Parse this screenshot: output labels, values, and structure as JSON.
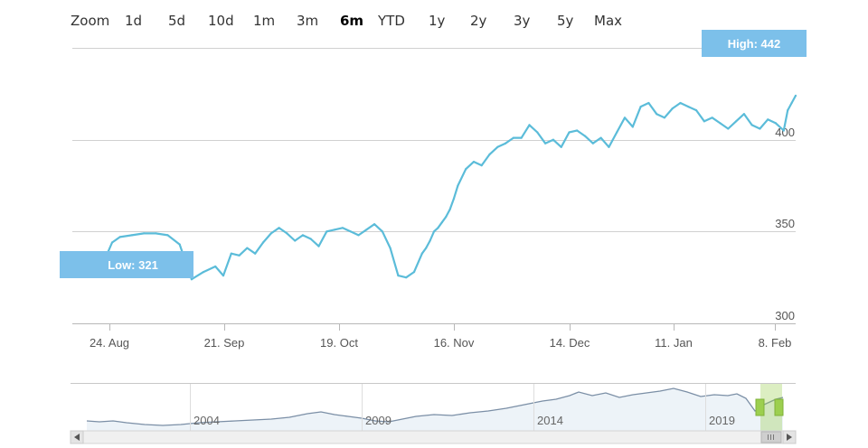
{
  "zoom": {
    "label": "Zoom",
    "buttons": [
      "1d",
      "5d",
      "10d",
      "1m",
      "3m",
      "6m",
      "YTD",
      "1y",
      "2y",
      "3y",
      "5y",
      "Max"
    ],
    "active": "6m"
  },
  "colors": {
    "line": "#5bbcd9",
    "badge": "#7cc0ea",
    "grid": "#d0d0d0",
    "navigator_fill": "#edf3f8",
    "navigator_line": "#7b8fa6",
    "handle": "#9ccf4f"
  },
  "badges": {
    "high": "High: 442",
    "low": "Low: 321"
  },
  "chart_data": {
    "type": "line",
    "title": "",
    "xlabel": "",
    "ylabel": "",
    "ylim": [
      300,
      450
    ],
    "yticks": [
      300,
      350,
      400
    ],
    "grid": true,
    "xticks": [
      "24. Aug",
      "21. Sep",
      "19. Oct",
      "16. Nov",
      "14. Dec",
      "11. Jan",
      "8. Feb"
    ],
    "x_range": [
      "2019-08-12",
      "2020-02-10"
    ],
    "series": [
      {
        "x": [
          "2019-08-12",
          "2019-08-15",
          "2019-08-18",
          "2019-08-21",
          "2019-08-22",
          "2019-08-24",
          "2019-08-27",
          "2019-08-30",
          "2019-09-02",
          "2019-09-05",
          "2019-09-08",
          "2019-09-11",
          "2019-09-14",
          "2019-09-17",
          "2019-09-19",
          "2019-09-21",
          "2019-09-23",
          "2019-09-25",
          "2019-09-27",
          "2019-09-29",
          "2019-10-01",
          "2019-10-03",
          "2019-10-05",
          "2019-10-07",
          "2019-10-09",
          "2019-10-11",
          "2019-10-13",
          "2019-10-15",
          "2019-10-17",
          "2019-10-19",
          "2019-10-21",
          "2019-10-23",
          "2019-10-25",
          "2019-10-27",
          "2019-10-29",
          "2019-10-31",
          "2019-11-02",
          "2019-11-04",
          "2019-11-06",
          "2019-11-08",
          "2019-11-09",
          "2019-11-10",
          "2019-11-11",
          "2019-11-12",
          "2019-11-13",
          "2019-11-14",
          "2019-11-15",
          "2019-11-16",
          "2019-11-17",
          "2019-11-19",
          "2019-11-21",
          "2019-11-23",
          "2019-11-25",
          "2019-11-27",
          "2019-11-29",
          "2019-12-01",
          "2019-12-03",
          "2019-12-05",
          "2019-12-07",
          "2019-12-09",
          "2019-12-11",
          "2019-12-13",
          "2019-12-15",
          "2019-12-17",
          "2019-12-19",
          "2019-12-21",
          "2019-12-23",
          "2019-12-25",
          "2019-12-27",
          "2019-12-29",
          "2019-12-31",
          "2020-01-02",
          "2020-01-04",
          "2020-01-06",
          "2020-01-08",
          "2020-01-10",
          "2020-01-12",
          "2020-01-14",
          "2020-01-16",
          "2020-01-18",
          "2020-01-20",
          "2020-01-22",
          "2020-01-24",
          "2020-01-26",
          "2020-01-28",
          "2020-01-30",
          "2020-02-01",
          "2020-02-03",
          "2020-02-05",
          "2020-02-07",
          "2020-02-08",
          "2020-02-09",
          "2020-02-10"
        ],
        "values": [
          327,
          330,
          332,
          339,
          344,
          347,
          348,
          349,
          349,
          348,
          343,
          324,
          328,
          331,
          326,
          338,
          337,
          341,
          338,
          344,
          349,
          352,
          349,
          345,
          348,
          346,
          342,
          350,
          351,
          352,
          350,
          348,
          351,
          354,
          350,
          341,
          326,
          325,
          328,
          338,
          341,
          345,
          350,
          352,
          355,
          358,
          362,
          368,
          375,
          384,
          388,
          386,
          392,
          396,
          398,
          401,
          401,
          408,
          404,
          398,
          400,
          396,
          404,
          405,
          402,
          398,
          401,
          396,
          404,
          412,
          407,
          418,
          420,
          414,
          412,
          417,
          420,
          418,
          416,
          410,
          412,
          409,
          406,
          410,
          414,
          408,
          406,
          411,
          409,
          405,
          416,
          420,
          424
        ]
      }
    ],
    "navigator": {
      "labels": [
        "2004",
        "2009",
        "2014",
        "2019"
      ]
    }
  }
}
